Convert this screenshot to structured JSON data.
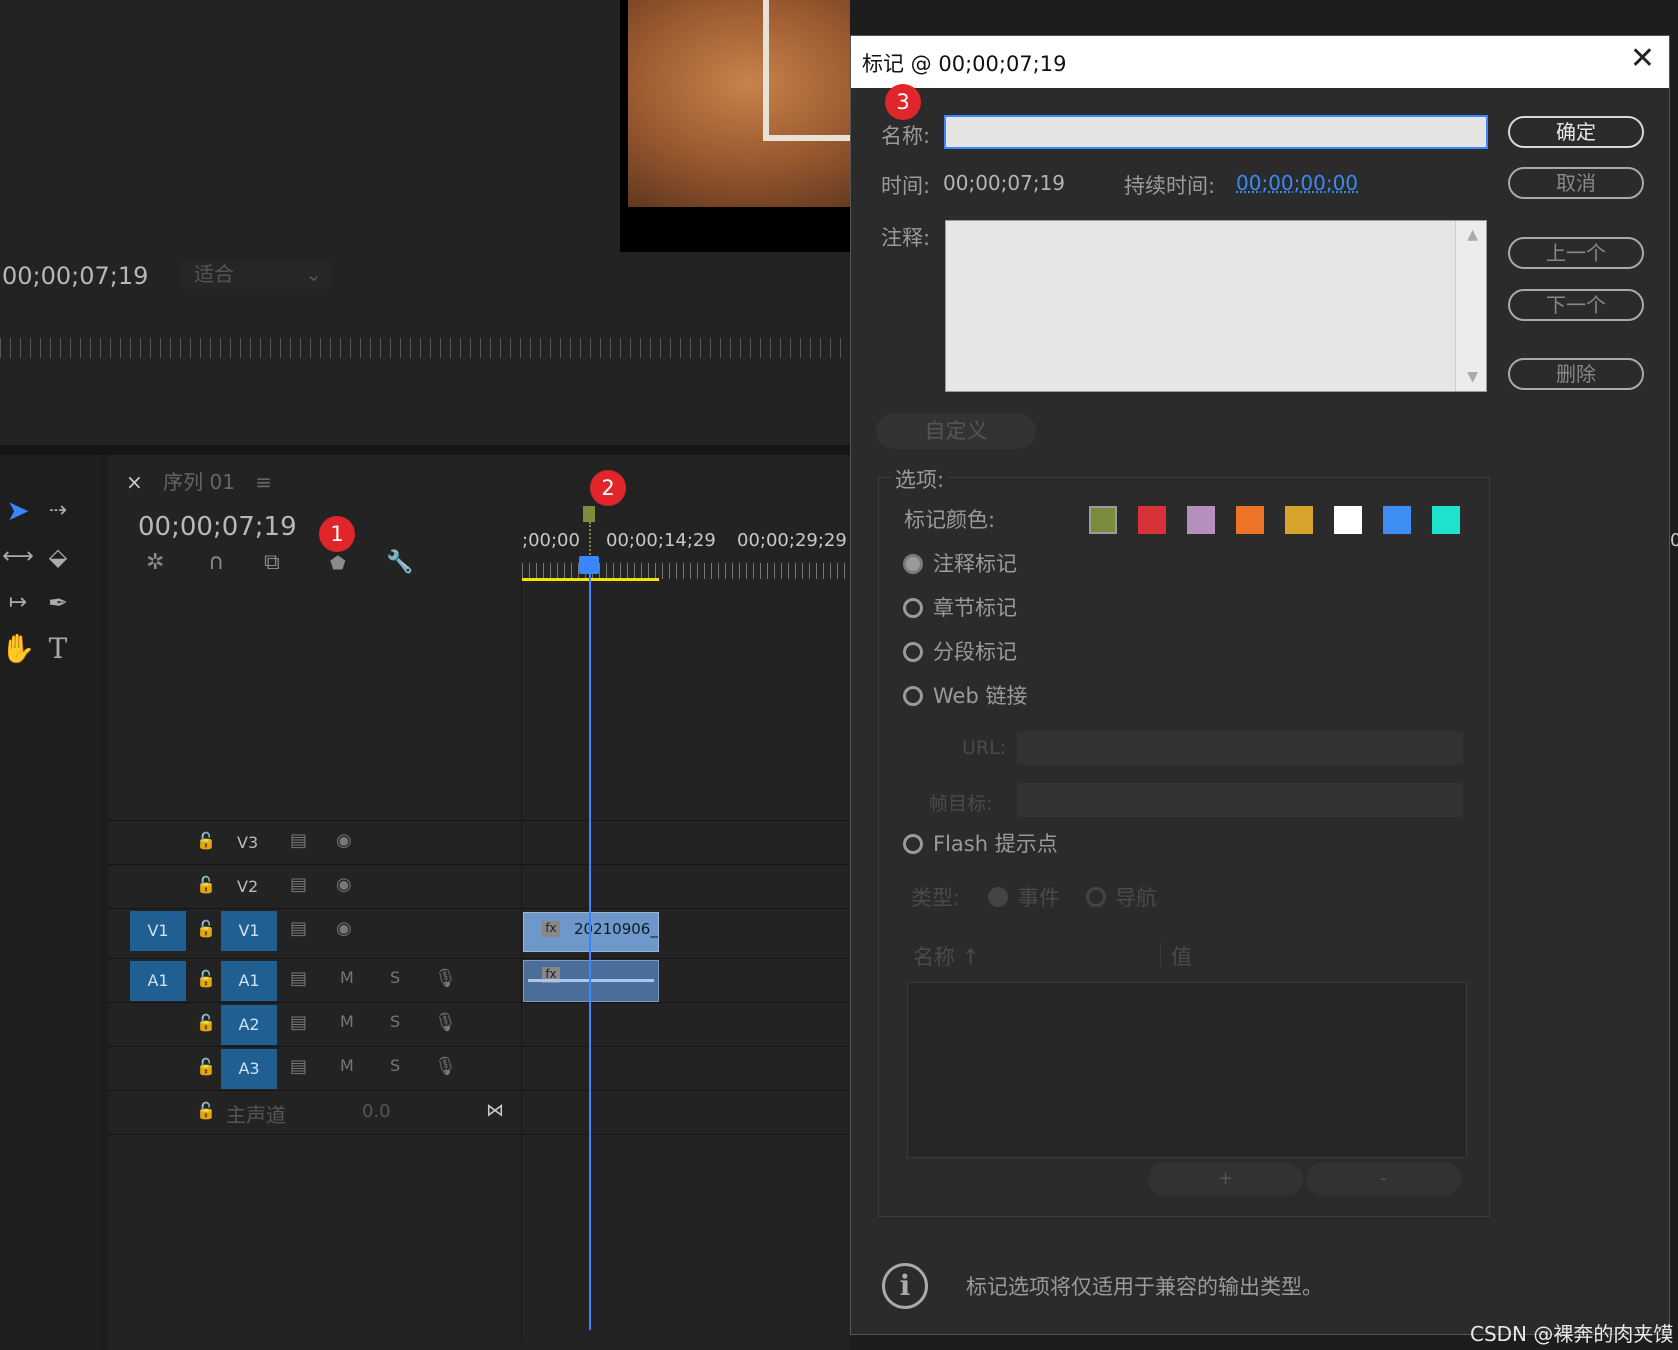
{
  "monitor": {
    "timecode": "00;00;07;19",
    "fit": "适合"
  },
  "sequence": {
    "close": "×",
    "tab": "序列 01",
    "menu": "≡",
    "timecode": "00;00;07;19"
  },
  "ruler": {
    "t0": ";00;00",
    "t1": "00;00;14;29",
    "t2": "00;00;29;29",
    "edge": "0"
  },
  "badges": [
    "1",
    "2",
    "3"
  ],
  "tracks": [
    {
      "src": "",
      "label": "V3",
      "type": "video"
    },
    {
      "src": "",
      "label": "V2",
      "type": "video"
    },
    {
      "src": "V1",
      "label": "V1",
      "type": "video"
    },
    {
      "src": "A1",
      "label": "A1",
      "type": "audio"
    },
    {
      "src": "",
      "label": "A2",
      "type": "audio"
    },
    {
      "src": "",
      "label": "A3",
      "type": "audio"
    }
  ],
  "master": {
    "label": "主声道",
    "value": "0.0"
  },
  "track_buttons": {
    "mute": "M",
    "solo": "S"
  },
  "clip": {
    "name": "20210906_",
    "fx": "fx"
  },
  "dialog": {
    "title": "标记 @ 00;00;07;19",
    "name_label": "名称:",
    "name_value": "",
    "time_label": "时间:",
    "time_value": "00;00;07;19",
    "duration_label": "持续时间:",
    "duration_value": "00;00;00;00",
    "comment_label": "注释:",
    "buttons": {
      "ok": "确定",
      "cancel": "取消",
      "prev": "上一个",
      "next": "下一个",
      "delete": "删除"
    },
    "custom": "自定义",
    "options_title": "选项:",
    "color_label": "标记颜色:",
    "colors": [
      "#7a8c3e",
      "#d9313a",
      "#b58fbe",
      "#ec7426",
      "#d9a42c",
      "#ffffff",
      "#3d8ef0",
      "#1fe3cf"
    ],
    "marker_types": [
      "注释标记",
      "章节标记",
      "分段标记",
      "Web 链接",
      "Flash 提示点"
    ],
    "url_label": "URL:",
    "frame_target_label": "帧目标:",
    "type_label": "类型:",
    "type_event": "事件",
    "type_nav": "导航",
    "col_name": "名称",
    "col_value": "值",
    "plus": "+",
    "minus": "-",
    "info": "标记选项将仅适用于兼容的输出类型。"
  },
  "watermark": "CSDN @裸奔的肉夹馍",
  "icons": [
    "close-icon",
    "info-icon",
    "lock-icon",
    "eye-icon",
    "mic-icon",
    "marker-icon",
    "wrench-icon",
    "snap-icon",
    "linked-selection-icon",
    "selection-tool-icon",
    "razor-tool-icon",
    "pen-tool-icon",
    "hand-tool-icon",
    "type-tool-icon"
  ]
}
